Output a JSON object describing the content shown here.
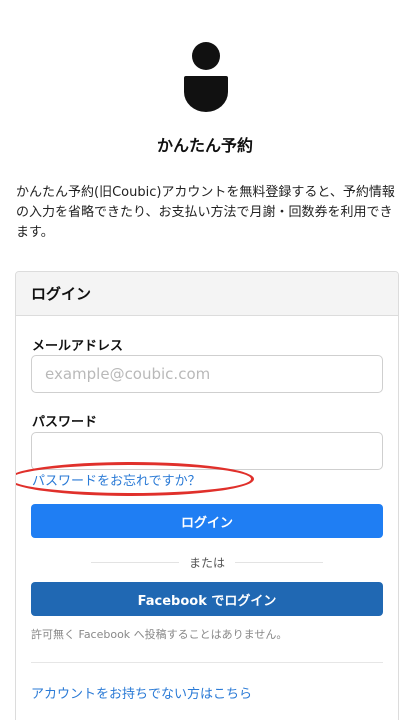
{
  "app": {
    "title": "かんたん予約",
    "intro_line1": "かんたん予約(旧Coubic)アカウントを無料登録すると、予約情報",
    "intro_line2": "の入力を省略できたり、お支払い方法で月謝・回数券を利用でき",
    "intro_line3": "ます。"
  },
  "login_card": {
    "header": "ログイン",
    "email": {
      "label": "メールアドレス",
      "placeholder": "example@coubic.com",
      "value": ""
    },
    "password": {
      "label": "パスワード",
      "value": ""
    },
    "forgot_password_link": "パスワードをお忘れですか？",
    "login_button": "ログイン",
    "divider_text": "または",
    "facebook_button": "Facebook でログイン",
    "facebook_note": "許可無く Facebook へ投稿することはありません。",
    "no_account_link": "アカウントをお持ちでない方はこちら"
  },
  "colors": {
    "primary": "#1f7ef3",
    "facebook": "#2068b3",
    "link": "#2a7ad6",
    "annotation": "#e0302b"
  }
}
